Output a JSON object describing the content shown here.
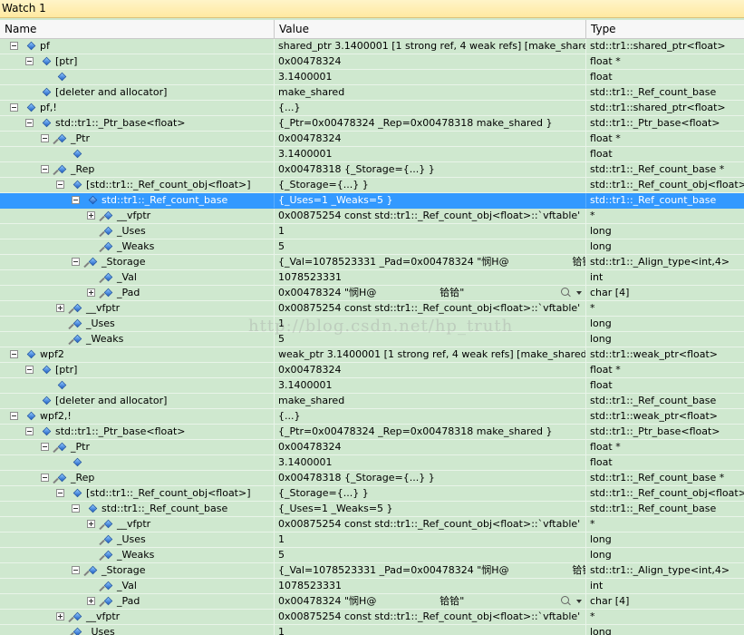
{
  "window": {
    "title": "Watch 1"
  },
  "columns": {
    "name": "Name",
    "value": "Value",
    "type": "Type"
  },
  "watermark": "http://blog.csdn.net/hp_truth",
  "rows": [
    {
      "indent": 0,
      "expander": "minus",
      "wrench": false,
      "name": "pf",
      "value": "shared_ptr 3.1400001 [1 strong ref, 4 weak refs] [make_shared]",
      "type": "std::tr1::shared_ptr<float>"
    },
    {
      "indent": 1,
      "expander": "minus",
      "wrench": false,
      "name": "[ptr]",
      "value": "0x00478324",
      "type": "float *"
    },
    {
      "indent": 2,
      "expander": "none",
      "wrench": false,
      "name": "",
      "value": "3.1400001",
      "type": "float"
    },
    {
      "indent": 1,
      "expander": "none",
      "wrench": false,
      "name": "[deleter and allocator]",
      "value": "make_shared",
      "type": "std::tr1::_Ref_count_base"
    },
    {
      "indent": 0,
      "expander": "minus",
      "wrench": false,
      "name": "pf,!",
      "value": "{...}",
      "type": "std::tr1::shared_ptr<float>"
    },
    {
      "indent": 1,
      "expander": "minus",
      "wrench": false,
      "name": "std::tr1::_Ptr_base<float>",
      "value": "{_Ptr=0x00478324 _Rep=0x00478318 make_shared }",
      "type": "std::tr1::_Ptr_base<float>"
    },
    {
      "indent": 2,
      "expander": "minus",
      "wrench": true,
      "name": "_Ptr",
      "value": "0x00478324",
      "type": "float *"
    },
    {
      "indent": 3,
      "expander": "none",
      "wrench": false,
      "name": "",
      "value": "3.1400001",
      "type": "float"
    },
    {
      "indent": 2,
      "expander": "minus",
      "wrench": true,
      "name": "_Rep",
      "value": "0x00478318 {_Storage={...} }",
      "type": "std::tr1::_Ref_count_base *"
    },
    {
      "indent": 3,
      "expander": "minus",
      "wrench": false,
      "name": "[std::tr1::_Ref_count_obj<float>]",
      "value": "{_Storage={...} }",
      "type": "std::tr1::_Ref_count_obj<float>"
    },
    {
      "indent": 4,
      "expander": "minus",
      "wrench": false,
      "name": "std::tr1::_Ref_count_base",
      "value": "{_Uses=1 _Weaks=5 }",
      "type": "std::tr1::_Ref_count_base",
      "selected": true
    },
    {
      "indent": 5,
      "expander": "plus",
      "wrench": true,
      "name": "__vfptr",
      "value": "0x00875254 const std::tr1::_Ref_count_obj<float>::`vftable'",
      "type": "*"
    },
    {
      "indent": 5,
      "expander": "none",
      "wrench": true,
      "name": "_Uses",
      "value": "1",
      "type": "long"
    },
    {
      "indent": 5,
      "expander": "none",
      "wrench": true,
      "name": "_Weaks",
      "value": "5",
      "type": "long"
    },
    {
      "indent": 4,
      "expander": "minus",
      "wrench": true,
      "name": "_Storage",
      "value": "{_Val=1078523331 _Pad=0x00478324 \"悯H@                    铪铪\" }",
      "type": "std::tr1::_Align_type<int,4>"
    },
    {
      "indent": 5,
      "expander": "none",
      "wrench": true,
      "name": "_Val",
      "value": "1078523331",
      "type": "int"
    },
    {
      "indent": 5,
      "expander": "plus",
      "wrench": true,
      "name": "_Pad",
      "value": "0x00478324 \"悯H@                    铪铪\"",
      "type": "char [4]",
      "viewer": true
    },
    {
      "indent": 3,
      "expander": "plus",
      "wrench": true,
      "name": "__vfptr",
      "value": "0x00875254 const std::tr1::_Ref_count_obj<float>::`vftable'",
      "type": "*"
    },
    {
      "indent": 3,
      "expander": "none",
      "wrench": true,
      "name": "_Uses",
      "value": "1",
      "type": "long"
    },
    {
      "indent": 3,
      "expander": "none",
      "wrench": true,
      "name": "_Weaks",
      "value": "5",
      "type": "long"
    },
    {
      "indent": 0,
      "expander": "minus",
      "wrench": false,
      "name": "wpf2",
      "value": "weak_ptr 3.1400001 [1 strong ref, 4 weak refs] [make_shared]",
      "type": "std::tr1::weak_ptr<float>"
    },
    {
      "indent": 1,
      "expander": "minus",
      "wrench": false,
      "name": "[ptr]",
      "value": "0x00478324",
      "type": "float *"
    },
    {
      "indent": 2,
      "expander": "none",
      "wrench": false,
      "name": "",
      "value": "3.1400001",
      "type": "float"
    },
    {
      "indent": 1,
      "expander": "none",
      "wrench": false,
      "name": "[deleter and allocator]",
      "value": "make_shared",
      "type": "std::tr1::_Ref_count_base"
    },
    {
      "indent": 0,
      "expander": "minus",
      "wrench": false,
      "name": "wpf2,!",
      "value": "{...}",
      "type": "std::tr1::weak_ptr<float>"
    },
    {
      "indent": 1,
      "expander": "minus",
      "wrench": false,
      "name": "std::tr1::_Ptr_base<float>",
      "value": "{_Ptr=0x00478324 _Rep=0x00478318 make_shared }",
      "type": "std::tr1::_Ptr_base<float>"
    },
    {
      "indent": 2,
      "expander": "minus",
      "wrench": true,
      "name": "_Ptr",
      "value": "0x00478324",
      "type": "float *"
    },
    {
      "indent": 3,
      "expander": "none",
      "wrench": false,
      "name": "",
      "value": "3.1400001",
      "type": "float"
    },
    {
      "indent": 2,
      "expander": "minus",
      "wrench": true,
      "name": "_Rep",
      "value": "0x00478318 {_Storage={...} }",
      "type": "std::tr1::_Ref_count_base *"
    },
    {
      "indent": 3,
      "expander": "minus",
      "wrench": false,
      "name": "[std::tr1::_Ref_count_obj<float>]",
      "value": "{_Storage={...} }",
      "type": "std::tr1::_Ref_count_obj<float>"
    },
    {
      "indent": 4,
      "expander": "minus",
      "wrench": false,
      "name": "std::tr1::_Ref_count_base",
      "value": "{_Uses=1 _Weaks=5 }",
      "type": "std::tr1::_Ref_count_base"
    },
    {
      "indent": 5,
      "expander": "plus",
      "wrench": true,
      "name": "__vfptr",
      "value": "0x00875254 const std::tr1::_Ref_count_obj<float>::`vftable'",
      "type": "*"
    },
    {
      "indent": 5,
      "expander": "none",
      "wrench": true,
      "name": "_Uses",
      "value": "1",
      "type": "long"
    },
    {
      "indent": 5,
      "expander": "none",
      "wrench": true,
      "name": "_Weaks",
      "value": "5",
      "type": "long"
    },
    {
      "indent": 4,
      "expander": "minus",
      "wrench": true,
      "name": "_Storage",
      "value": "{_Val=1078523331 _Pad=0x00478324 \"悯H@                    铪铪\" }",
      "type": "std::tr1::_Align_type<int,4>"
    },
    {
      "indent": 5,
      "expander": "none",
      "wrench": true,
      "name": "_Val",
      "value": "1078523331",
      "type": "int"
    },
    {
      "indent": 5,
      "expander": "plus",
      "wrench": true,
      "name": "_Pad",
      "value": "0x00478324 \"悯H@                    铪铪\"",
      "type": "char [4]",
      "viewer": true
    },
    {
      "indent": 3,
      "expander": "plus",
      "wrench": true,
      "name": "__vfptr",
      "value": "0x00875254 const std::tr1::_Ref_count_obj<float>::`vftable'",
      "type": "*"
    },
    {
      "indent": 3,
      "expander": "none",
      "wrench": true,
      "name": "_Uses",
      "value": "1",
      "type": "long"
    }
  ]
}
